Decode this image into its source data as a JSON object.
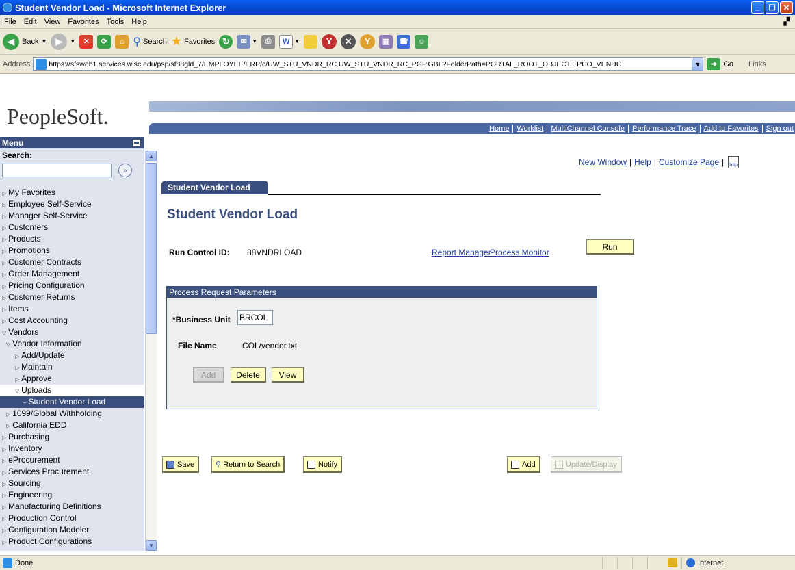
{
  "window": {
    "title": "Student Vendor Load - Microsoft Internet Explorer"
  },
  "menubar": {
    "items": [
      "File",
      "Edit",
      "View",
      "Favorites",
      "Tools",
      "Help"
    ]
  },
  "toolbar": {
    "back": "Back",
    "search": "Search",
    "favorites": "Favorites"
  },
  "address": {
    "label": "Address",
    "url": "https://sfsweb1.services.wisc.edu/psp/sf88gld_7/EMPLOYEE/ERP/c/UW_STU_VNDR_RC.UW_STU_VNDR_RC_PGP.GBL?FolderPath=PORTAL_ROOT_OBJECT.EPCO_VENDC",
    "go": "Go",
    "links": "Links"
  },
  "header": {
    "logo": "PeopleSoft.",
    "nav": [
      "Home",
      "Worklist",
      "MultiChannel Console",
      "Performance Trace",
      "Add to Favorites",
      "Sign out"
    ]
  },
  "menu": {
    "title": "Menu",
    "search_label": "Search:",
    "items": [
      {
        "label": "My Favorites",
        "indent": 0,
        "state": "collapsed"
      },
      {
        "label": "Employee Self-Service",
        "indent": 0,
        "state": "collapsed"
      },
      {
        "label": "Manager Self-Service",
        "indent": 0,
        "state": "collapsed"
      },
      {
        "label": "Customers",
        "indent": 0,
        "state": "collapsed"
      },
      {
        "label": "Products",
        "indent": 0,
        "state": "collapsed"
      },
      {
        "label": "Promotions",
        "indent": 0,
        "state": "collapsed"
      },
      {
        "label": "Customer Contracts",
        "indent": 0,
        "state": "collapsed"
      },
      {
        "label": "Order Management",
        "indent": 0,
        "state": "collapsed"
      },
      {
        "label": "Pricing Configuration",
        "indent": 0,
        "state": "collapsed"
      },
      {
        "label": "Customer Returns",
        "indent": 0,
        "state": "collapsed"
      },
      {
        "label": "Items",
        "indent": 0,
        "state": "collapsed"
      },
      {
        "label": "Cost Accounting",
        "indent": 0,
        "state": "collapsed"
      },
      {
        "label": "Vendors",
        "indent": 0,
        "state": "expanded"
      },
      {
        "label": "Vendor Information",
        "indent": 1,
        "state": "expanded"
      },
      {
        "label": "Add/Update",
        "indent": 2,
        "state": "collapsed"
      },
      {
        "label": "Maintain",
        "indent": 2,
        "state": "collapsed"
      },
      {
        "label": "Approve",
        "indent": 2,
        "state": "collapsed"
      },
      {
        "label": "Uploads",
        "indent": 2,
        "state": "expanded-selected"
      },
      {
        "label": "Student Vendor Load",
        "indent": 3,
        "state": "current"
      },
      {
        "label": "1099/Global Withholding",
        "indent": 1,
        "state": "collapsed"
      },
      {
        "label": "California EDD",
        "indent": 1,
        "state": "collapsed"
      },
      {
        "label": "Purchasing",
        "indent": 0,
        "state": "collapsed"
      },
      {
        "label": "Inventory",
        "indent": 0,
        "state": "collapsed"
      },
      {
        "label": "eProcurement",
        "indent": 0,
        "state": "collapsed"
      },
      {
        "label": "Services Procurement",
        "indent": 0,
        "state": "collapsed"
      },
      {
        "label": "Sourcing",
        "indent": 0,
        "state": "collapsed"
      },
      {
        "label": "Engineering",
        "indent": 0,
        "state": "collapsed"
      },
      {
        "label": "Manufacturing Definitions",
        "indent": 0,
        "state": "collapsed"
      },
      {
        "label": "Production Control",
        "indent": 0,
        "state": "collapsed"
      },
      {
        "label": "Configuration Modeler",
        "indent": 0,
        "state": "collapsed"
      },
      {
        "label": "Product Configurations",
        "indent": 0,
        "state": "collapsed"
      }
    ]
  },
  "top_links": {
    "new_window": "New Window",
    "help": "Help",
    "customize": "Customize Page",
    "http": "http"
  },
  "page": {
    "tab": "Student Vendor Load",
    "title": "Student Vendor Load",
    "run_control_label": "Run Control ID:",
    "run_control_value": "88VNDRLOAD",
    "report_manager": "Report Manager",
    "process_monitor": "Process Monitor",
    "run": "Run",
    "group_title": "Process Request Parameters",
    "business_unit_label": "*Business Unit",
    "business_unit_value": "BRCOL",
    "file_name_label": "File Name",
    "file_name_value": "COL/vendor.txt",
    "add": "Add",
    "delete": "Delete",
    "view": "View"
  },
  "footer_buttons": {
    "save": "Save",
    "return_to_search": "Return to Search",
    "notify": "Notify",
    "add": "Add",
    "update_display": "Update/Display"
  },
  "status": {
    "text": "Done",
    "zone": "Internet"
  },
  "colors": {
    "accent": "#3a4f7e",
    "button_yellow": "#ffffc0",
    "link": "#1f3c99"
  }
}
